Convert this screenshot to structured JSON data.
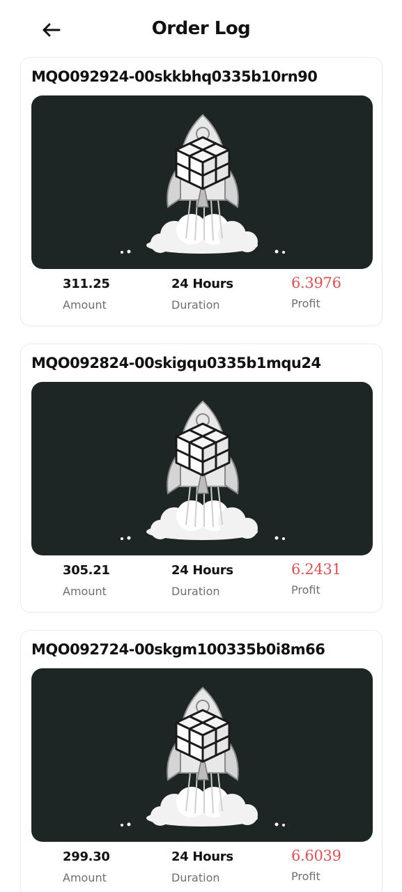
{
  "header": {
    "title": "Order Log",
    "back_icon": "arrow-left-icon"
  },
  "colors": {
    "profit": "#e0514f",
    "banner_bg": "#1d2624"
  },
  "orders": [
    {
      "id": "MQO092924-00skkbhq0335b10rn90",
      "amount": "311.25",
      "amount_label": "Amount",
      "duration": "24 Hours",
      "duration_label": "Duration",
      "profit": "6.3976",
      "profit_label": "Profit",
      "image": "rocket-cube-illustration"
    },
    {
      "id": "MQO092824-00skigqu0335b1mqu24",
      "amount": "305.21",
      "amount_label": "Amount",
      "duration": "24 Hours",
      "duration_label": "Duration",
      "profit": "6.2431",
      "profit_label": "Profit",
      "image": "rocket-cube-illustration"
    },
    {
      "id": "MQO092724-00skgm100335b0i8m66",
      "amount": "299.30",
      "amount_label": "Amount",
      "duration": "24 Hours",
      "duration_label": "Duration",
      "profit": "6.6039",
      "profit_label": "Profit",
      "image": "rocket-cube-illustration"
    }
  ]
}
